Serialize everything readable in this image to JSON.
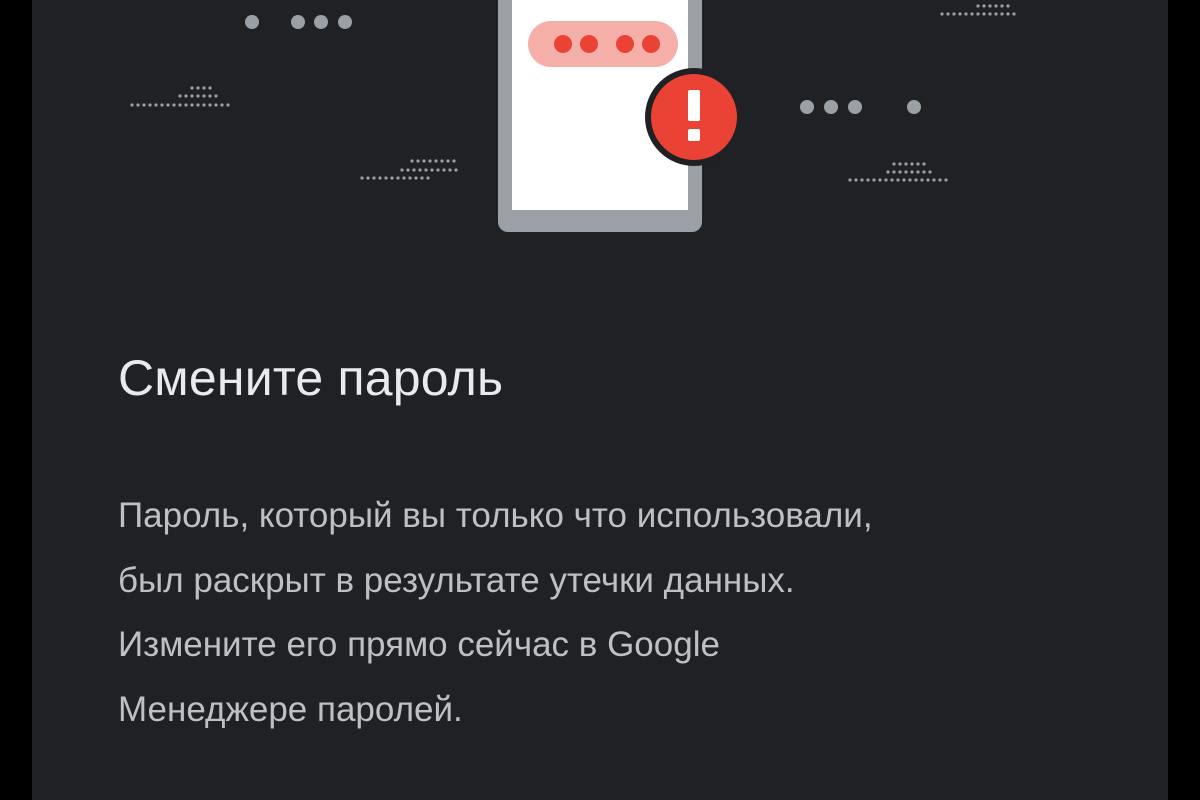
{
  "dialog": {
    "title": "Смените пароль",
    "message_lines": [
      "Пароль, который вы только что использовали,",
      "был раскрыт в результате утечки данных.",
      "Измените его прямо сейчас в Google",
      "Менеджере паролей."
    ]
  },
  "illustration": {
    "phone_icon": "phone-icon",
    "password_dots_icon": "password-dots-icon",
    "alert_icon": "exclamation-alert-icon",
    "colors": {
      "background": "#202124",
      "phone_frame": "#9aa0a6",
      "phone_screen": "#ffffff",
      "password_field": "#f6aea9",
      "password_dot": "#ea4335",
      "alert_badge": "#ea4335",
      "decorative_dots": "#9aa0a6"
    }
  }
}
